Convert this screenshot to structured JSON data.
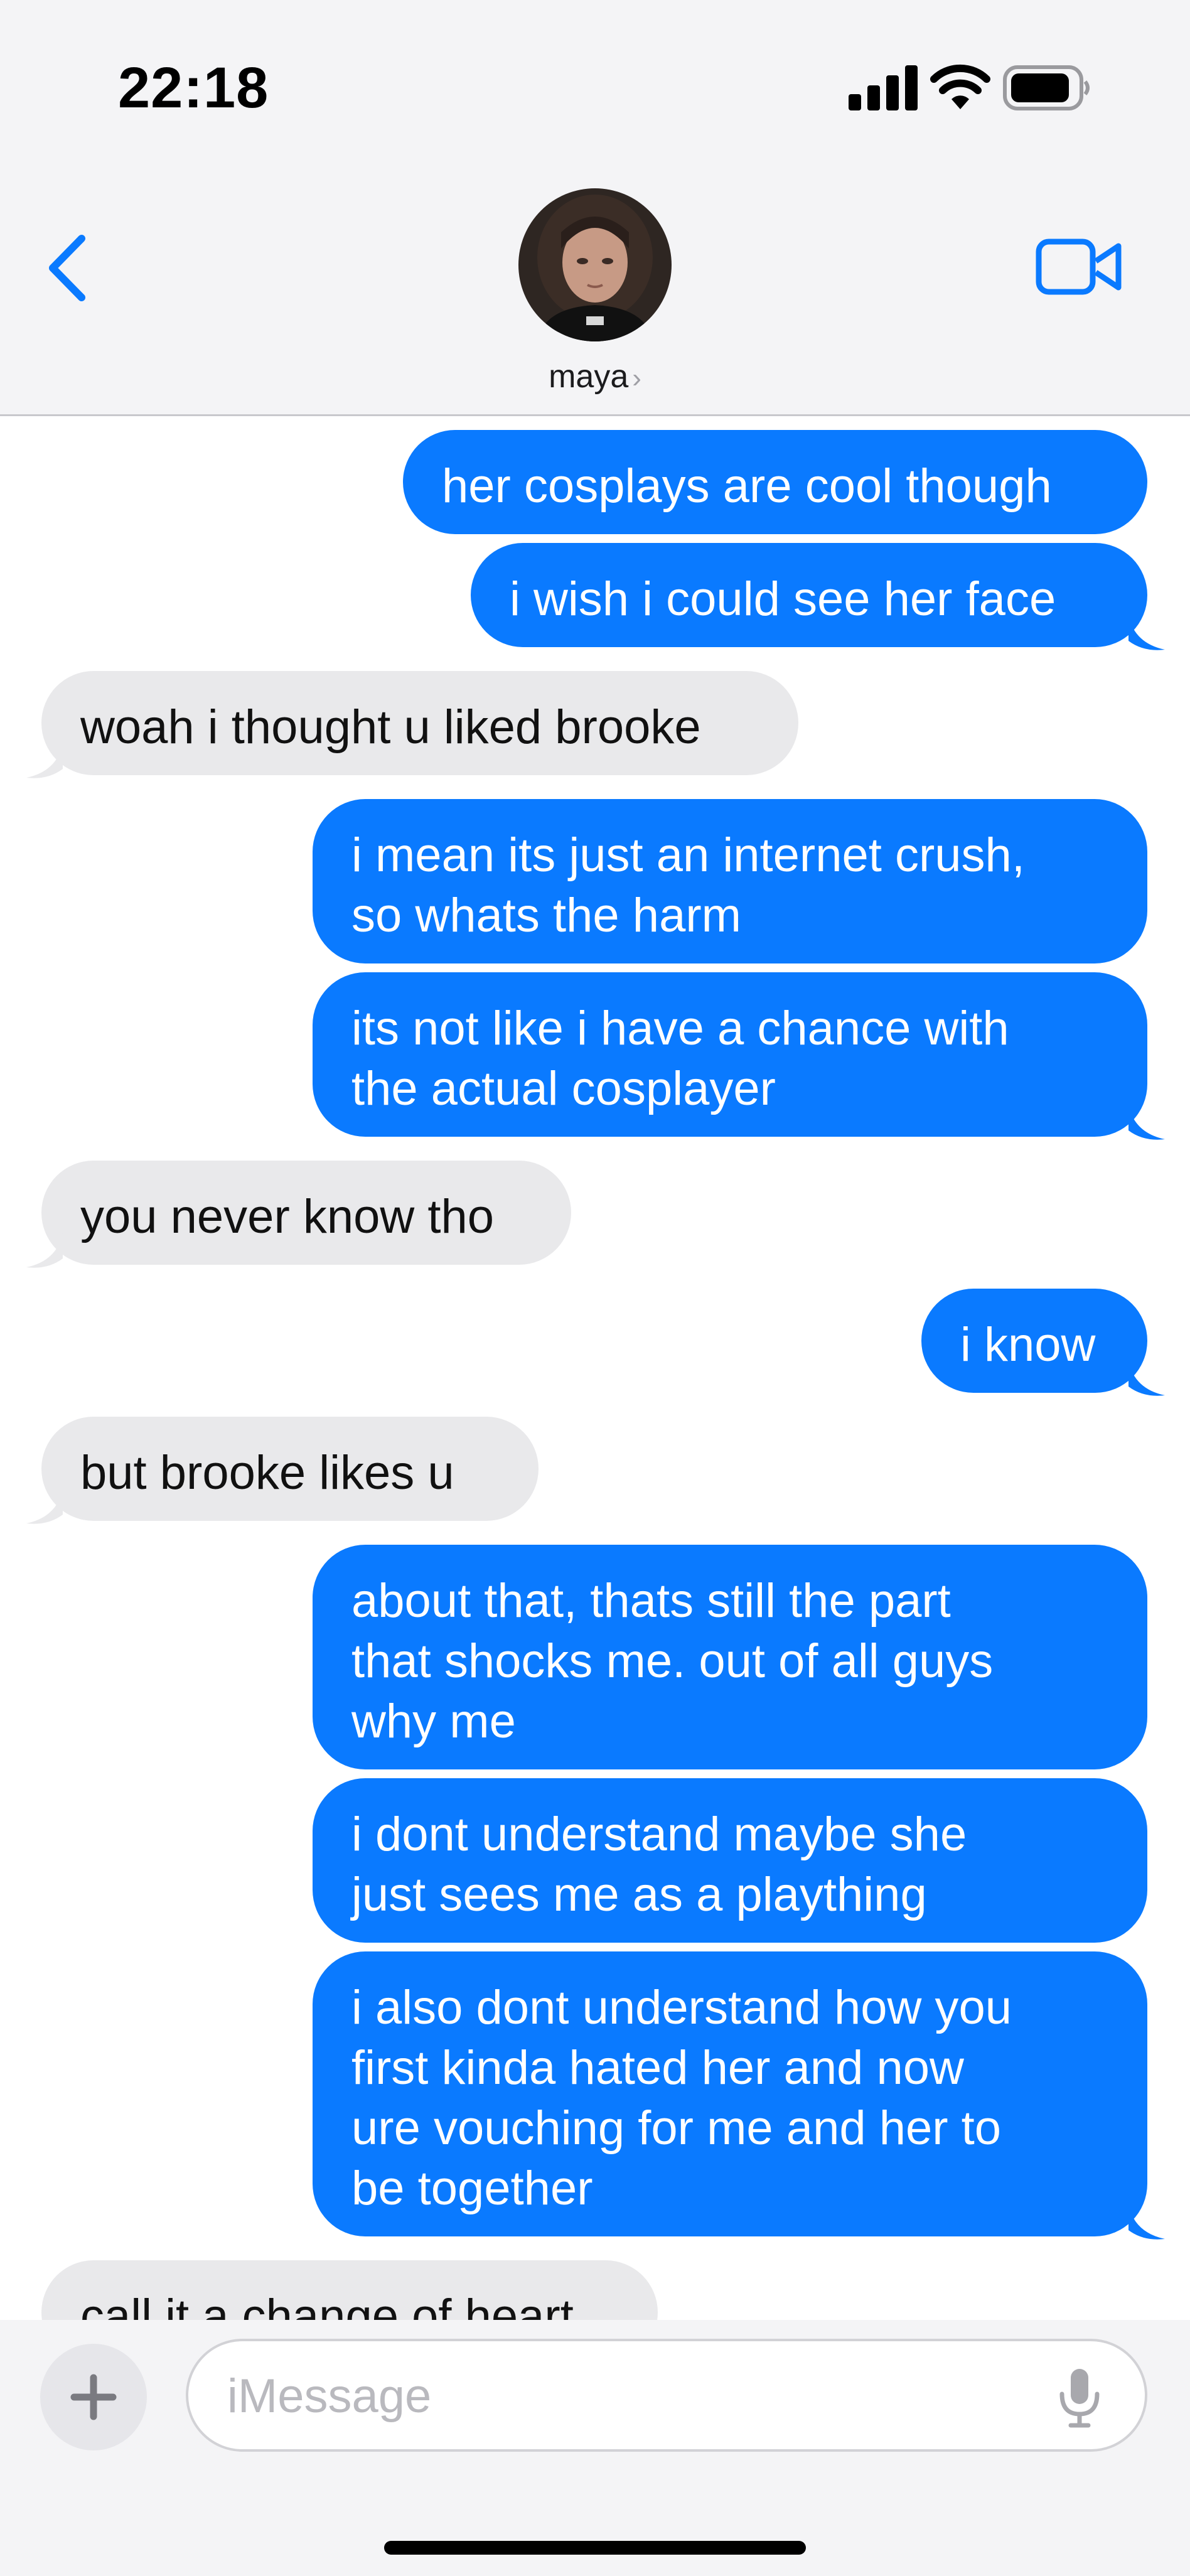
{
  "status_bar": {
    "time": "22:18"
  },
  "header": {
    "contact_name": "maya",
    "chevron": "›"
  },
  "icons": {
    "back": "chevron-left-icon",
    "video": "video-camera-icon",
    "plus": "plus-icon",
    "mic": "microphone-icon"
  },
  "colors": {
    "outgoing_bubble": "#0a7aff",
    "incoming_bubble": "#e9e9eb",
    "accent": "#0a7aff"
  },
  "messages": [
    {
      "direction": "outgoing",
      "text": "her cosplays are cool though"
    },
    {
      "direction": "outgoing",
      "text": "i wish i could see her face"
    },
    {
      "direction": "incoming",
      "text": "woah i thought u liked brooke"
    },
    {
      "direction": "outgoing",
      "text": "i mean its just an internet crush,\nso whats the harm"
    },
    {
      "direction": "outgoing",
      "text": "its not like i have a chance with\nthe actual cosplayer"
    },
    {
      "direction": "incoming",
      "text": "you never know tho"
    },
    {
      "direction": "outgoing",
      "text": "i know"
    },
    {
      "direction": "incoming",
      "text": "but brooke likes u"
    },
    {
      "direction": "outgoing",
      "text": "about that, thats still the part\nthat shocks me. out of all guys\nwhy me"
    },
    {
      "direction": "outgoing",
      "text": "i dont understand maybe she\njust sees me as a plaything"
    },
    {
      "direction": "outgoing",
      "text": "i also dont understand how you\nfirst kinda hated her and now\nure vouching for me and her to\nbe together"
    },
    {
      "direction": "incoming",
      "text": "call it a change of heart"
    }
  ],
  "composer": {
    "placeholder": "iMessage"
  }
}
